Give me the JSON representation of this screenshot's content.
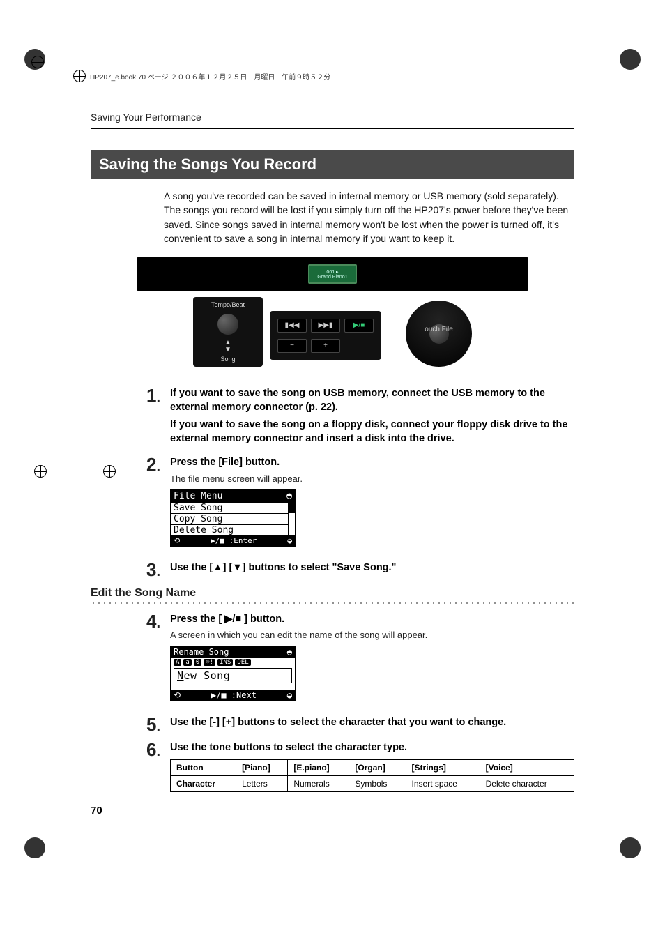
{
  "header_stamp": "HP207_e.book  70 ページ  ２００６年１２月２５日　月曜日　午前９時５２分",
  "running_head": "Saving Your Performance",
  "section_title": "Saving the Songs You Record",
  "intro": "A song you've recorded can be saved in internal memory or USB memory (sold separately). The songs you record will be lost if you simply turn off the HP207's power before they've been saved. Since songs saved in internal memory won't be lost when the power is turned off, it's convenient to save a song in internal memory if you want to keep it.",
  "panel": {
    "lcd_line1": "001 ▸",
    "lcd_line2": "Grand Piano1",
    "tempo_label_top": "Tempo/Beat",
    "tempo_label_bottom": "Song",
    "file_label": "ouch  File"
  },
  "steps": {
    "s1": {
      "num": "1",
      "lead_a": "If you want to save the song on USB memory, connect the USB memory to the external memory connector (p. 22).",
      "lead_b": "If you want to save the song on a floppy disk, connect your floppy disk drive to the external memory connector and insert a disk into the drive."
    },
    "s2": {
      "num": "2",
      "lead": "Press the [File] button.",
      "sub": "The file menu screen will appear."
    },
    "file_menu": {
      "title": "File Menu",
      "items": [
        "Save Song",
        "Copy Song",
        "Delete Song"
      ],
      "foot": "▶/■ :Enter"
    },
    "s3": {
      "num": "3",
      "lead": "Use the [▲] [▼] buttons to select \"Save Song.\""
    }
  },
  "edit_name": {
    "heading": "Edit the Song Name",
    "s4": {
      "num": "4",
      "lead": "Press the [ ▶/■ ] button.",
      "sub": "A screen in which you can edit the name of the song will appear."
    },
    "rename": {
      "title": "Rename Song",
      "chips": [
        "A",
        "a",
        "0",
        "☼!",
        "INS",
        "DEL"
      ],
      "name_cursor": "N",
      "name_rest": "ew Song",
      "foot": "▶/■ :Next"
    },
    "s5": {
      "num": "5",
      "lead": "Use the [-] [+] buttons to select the character that you want to change."
    },
    "s6": {
      "num": "6",
      "lead": "Use the tone buttons to select the character type."
    },
    "table": {
      "head": [
        "Button",
        "[Piano]",
        "[E.piano]",
        "[Organ]",
        "[Strings]",
        "[Voice]"
      ],
      "row": [
        "Character",
        "Letters",
        "Numerals",
        "Symbols",
        "Insert space",
        "Delete character"
      ]
    }
  },
  "page_number": "70"
}
